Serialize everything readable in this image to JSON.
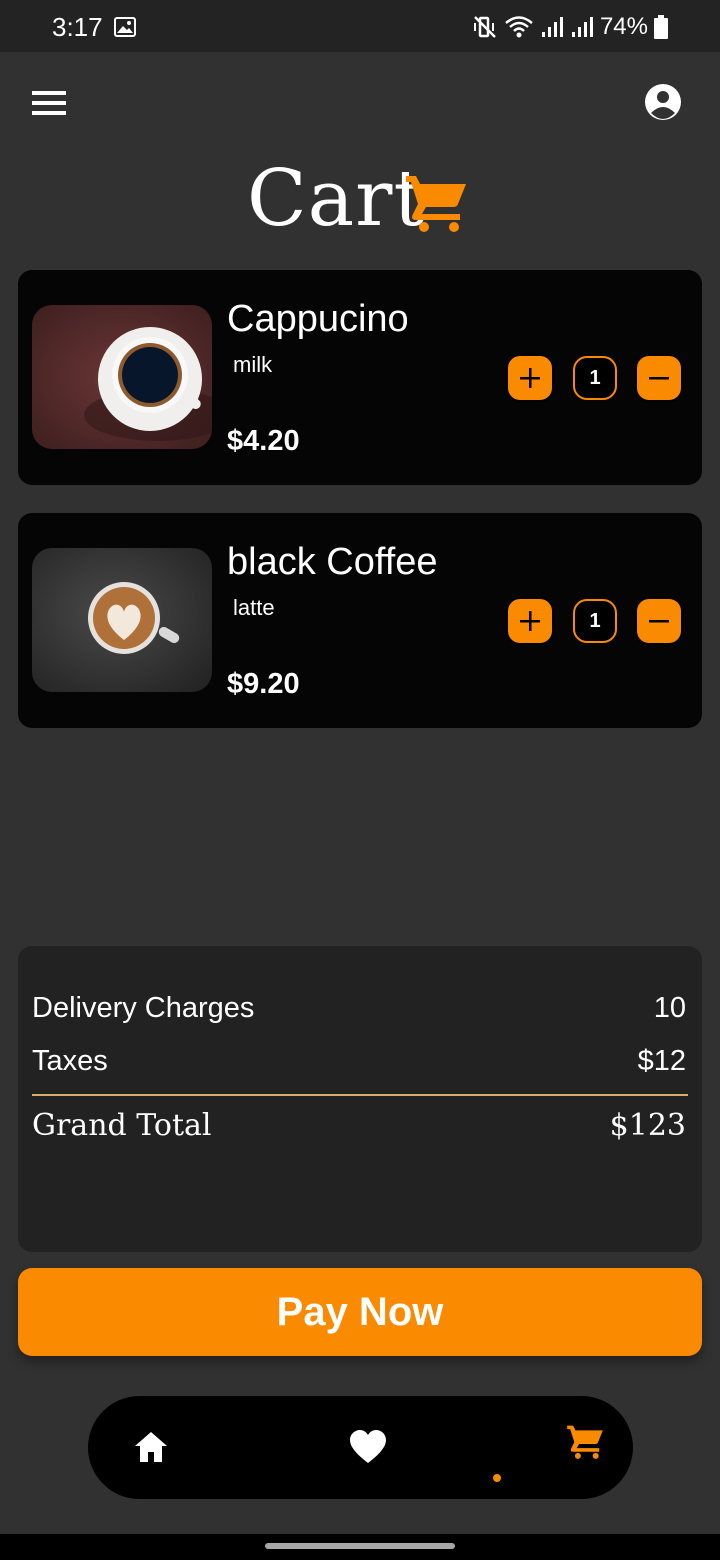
{
  "status_bar": {
    "time": "3:17",
    "battery": "74%",
    "icons": [
      "image-icon",
      "mute-vibrate-icon",
      "wifi-icon",
      "signal-icon",
      "signal-icon-2",
      "battery-icon"
    ]
  },
  "header": {
    "menu_icon": "hamburger-menu-icon",
    "profile_icon": "account-circle-icon"
  },
  "page_title": "Cart",
  "title_icon": "shopping-cart-icon",
  "cart_items": [
    {
      "name": "Cappucino",
      "sub": "milk",
      "price": "$4.20",
      "quantity": "1",
      "image": "coffee-cup-dark-image"
    },
    {
      "name": "black Coffee",
      "sub": "latte",
      "price": "$9.20",
      "quantity": "1",
      "image": "latte-art-image"
    }
  ],
  "summary": {
    "delivery_label": "Delivery Charges",
    "delivery_value": "10",
    "taxes_label": "Taxes",
    "taxes_value": "$12",
    "total_label": "Grand Total",
    "total_value": "$123"
  },
  "pay_button": "Pay Now",
  "bottom_nav": {
    "items": [
      "home-icon",
      "heart-icon",
      "cart-icon"
    ],
    "active": "cart-icon"
  },
  "colors": {
    "background": "#313131",
    "card": "#050505",
    "summary": "#222222",
    "accent": "#fa8a00",
    "divider": "#d8ad6d"
  }
}
